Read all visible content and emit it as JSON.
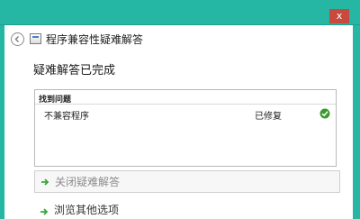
{
  "window": {
    "title": "程序兼容性疑难解答",
    "close_glyph": "x"
  },
  "main": {
    "heading": "疑难解答已完成",
    "results": {
      "section_title": "找到问题",
      "items": [
        {
          "problem": "不兼容程序",
          "status": "已修复",
          "status_icon": "check-icon"
        }
      ]
    },
    "actions": [
      {
        "label": "关闭疑难解答",
        "icon": "green-arrow-icon"
      },
      {
        "label": "浏览其他选项",
        "icon": "green-arrow-icon"
      }
    ]
  },
  "colors": {
    "titlebar": "#25b6a4",
    "close_button": "#c8493e",
    "success_check": "#3a9a2e",
    "action_arrow": "#3aa83a"
  }
}
